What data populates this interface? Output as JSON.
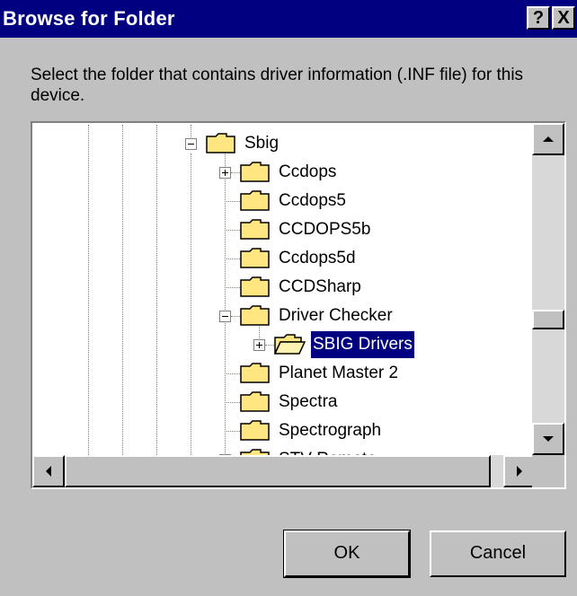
{
  "window": {
    "title": "Browse for Folder"
  },
  "titlebar": {
    "help_label": "?",
    "close_label": "X"
  },
  "instruction": "Select the folder that contains driver information (.INF file) for this device.",
  "tree": {
    "items": [
      {
        "label": "Sbig",
        "expander": "minus"
      },
      {
        "label": "Ccdops",
        "expander": "plus"
      },
      {
        "label": "Ccdops5",
        "expander": ""
      },
      {
        "label": "CCDOPS5b",
        "expander": ""
      },
      {
        "label": "Ccdops5d",
        "expander": ""
      },
      {
        "label": "CCDSharp",
        "expander": ""
      },
      {
        "label": "Driver Checker",
        "expander": "minus"
      },
      {
        "label": "SBIG Drivers",
        "expander": "plus",
        "selected": true
      },
      {
        "label": "Planet Master 2",
        "expander": ""
      },
      {
        "label": "Spectra",
        "expander": ""
      },
      {
        "label": "Spectrograph",
        "expander": ""
      },
      {
        "label": "STV Remote",
        "expander": "plus"
      }
    ]
  },
  "buttons": {
    "ok": "OK",
    "cancel": "Cancel"
  },
  "colors": {
    "titlebar": "#000080",
    "face": "#c0c0c0",
    "selection": "#000080",
    "folder": "#ffe680"
  }
}
